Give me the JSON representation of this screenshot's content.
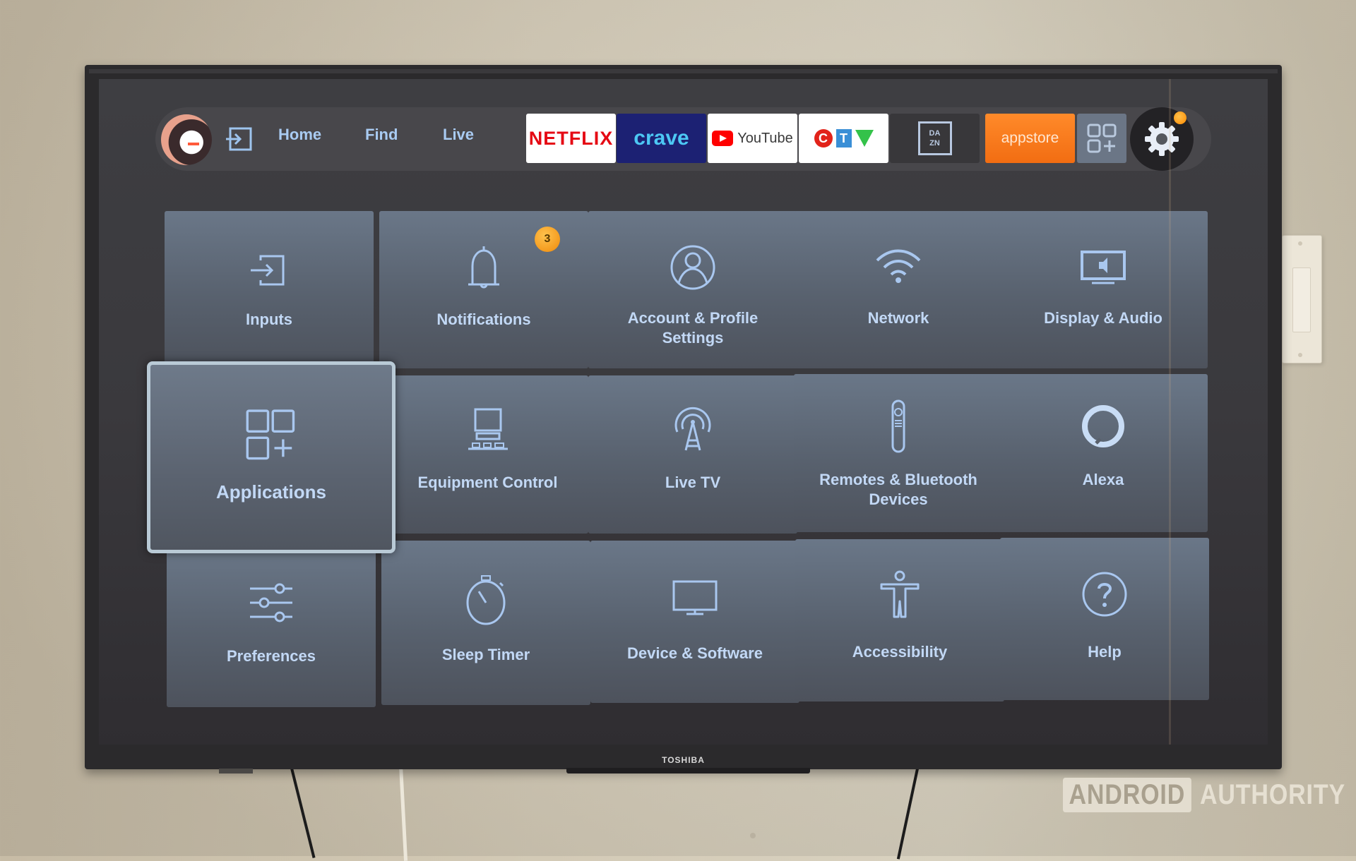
{
  "scene": {
    "tv_brand": "TOSHIBA",
    "watermark": {
      "boxed": "ANDROID",
      "plain": "AUTHORITY"
    }
  },
  "topbar": {
    "profile_icon": "profile-avatar",
    "input_icon": "input-switch-icon",
    "nav": [
      {
        "label": "Home"
      },
      {
        "label": "Find"
      },
      {
        "label": "Live"
      }
    ],
    "apps": [
      {
        "name": "Netflix",
        "label": "NETFLIX"
      },
      {
        "name": "Crave",
        "label": "crave"
      },
      {
        "name": "YouTube",
        "label": "YouTube"
      },
      {
        "name": "CTV",
        "c": "C",
        "t": "T"
      },
      {
        "name": "DAZN",
        "line1": "DA",
        "line2": "ZN"
      },
      {
        "name": "Appstore",
        "label": "appstore"
      },
      {
        "name": "More apps",
        "icon": "apps-add-icon"
      }
    ],
    "settings_icon": "gear-icon",
    "settings_notification": true
  },
  "settings_grid": {
    "focused_index": 5,
    "tiles": [
      {
        "label": "Inputs",
        "icon": "input-icon"
      },
      {
        "label": "Notifications",
        "icon": "bell-icon",
        "badge": "3"
      },
      {
        "label": "Account & Profile Settings",
        "icon": "account-icon"
      },
      {
        "label": "Network",
        "icon": "wifi-icon"
      },
      {
        "label": "Display & Audio",
        "icon": "display-audio-icon"
      },
      {
        "label": "Applications",
        "icon": "apps-icon"
      },
      {
        "label": "Equipment Control",
        "icon": "equipment-icon"
      },
      {
        "label": "Live TV",
        "icon": "antenna-icon"
      },
      {
        "label": "Remotes & Bluetooth Devices",
        "icon": "remote-icon"
      },
      {
        "label": "Alexa",
        "icon": "alexa-icon"
      },
      {
        "label": "Preferences",
        "icon": "sliders-icon"
      },
      {
        "label": "Sleep Timer",
        "icon": "stopwatch-icon"
      },
      {
        "label": "Device & Software",
        "icon": "monitor-icon"
      },
      {
        "label": "Accessibility",
        "icon": "accessibility-icon"
      },
      {
        "label": "Help",
        "icon": "help-icon"
      }
    ]
  },
  "colors": {
    "accent_text": "#a9cbf2",
    "badge": "#f5a623",
    "appstore": "#f26d12",
    "netflix": "#e50914",
    "crave_bg": "#1c2173"
  }
}
